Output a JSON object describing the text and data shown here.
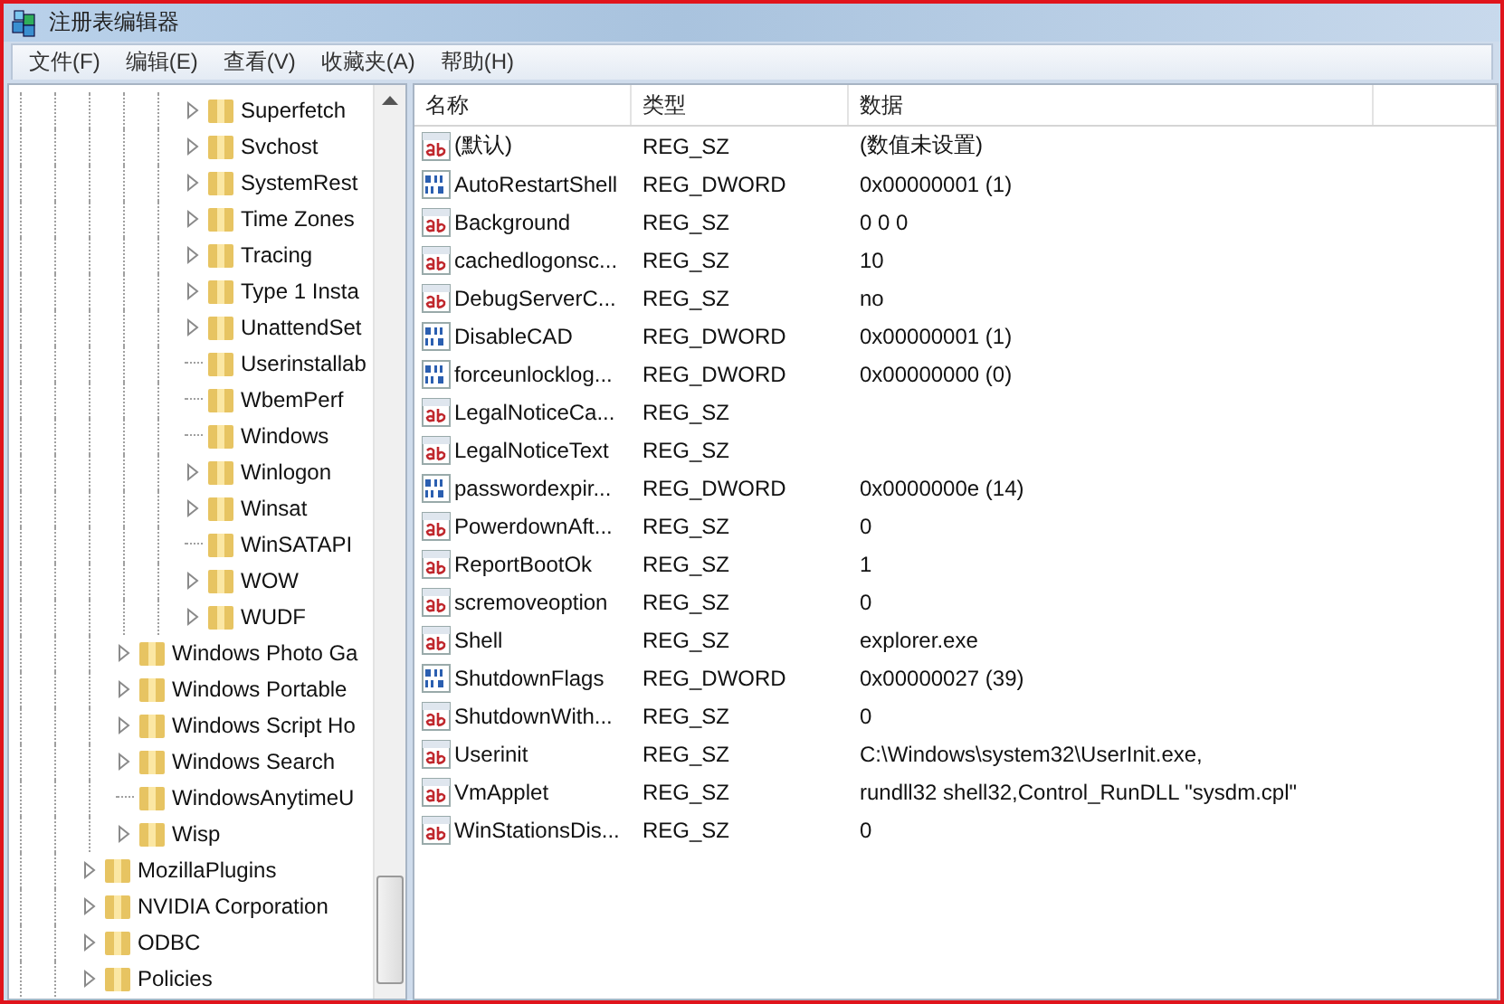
{
  "window": {
    "title": "注册表编辑器"
  },
  "menu": [
    "文件(F)",
    "编辑(E)",
    "查看(V)",
    "收藏夹(A)",
    "帮助(H)"
  ],
  "tree": {
    "items": [
      {
        "children": [
          {
            "children": [
              {
                "children": [
                  {
                    "label": "Superfetch",
                    "expandable": true
                  },
                  {
                    "label": "Svchost",
                    "expandable": true
                  },
                  {
                    "label": "SystemRest",
                    "expandable": true
                  },
                  {
                    "label": "Time Zones",
                    "expandable": true
                  },
                  {
                    "label": "Tracing",
                    "expandable": true
                  },
                  {
                    "label": "Type 1 Insta",
                    "expandable": true
                  },
                  {
                    "label": "UnattendSet",
                    "expandable": true
                  },
                  {
                    "label": "Userinstallab",
                    "expandable": false
                  },
                  {
                    "label": "WbemPerf",
                    "expandable": false
                  },
                  {
                    "label": "Windows",
                    "expandable": false
                  },
                  {
                    "label": "Winlogon",
                    "expandable": true
                  },
                  {
                    "label": "Winsat",
                    "expandable": true
                  },
                  {
                    "label": "WinSATAPI",
                    "expandable": false
                  },
                  {
                    "label": "WOW",
                    "expandable": true
                  },
                  {
                    "label": "WUDF",
                    "expandable": true
                  }
                ]
              }
            ]
          },
          {
            "label": "Windows Photo Ga",
            "expandable": true
          },
          {
            "label": "Windows Portable",
            "expandable": true
          },
          {
            "label": "Windows Script Ho",
            "expandable": true
          },
          {
            "label": "Windows Search",
            "expandable": true
          },
          {
            "label": "WindowsAnytimeU",
            "expandable": false
          },
          {
            "label": "Wisp",
            "expandable": true
          }
        ]
      },
      {
        "label": "MozillaPlugins",
        "expandable": true
      },
      {
        "label": "NVIDIA Corporation",
        "expandable": true
      },
      {
        "label": "ODBC",
        "expandable": true
      },
      {
        "label": "Policies",
        "expandable": true
      }
    ]
  },
  "table": {
    "columns": [
      "名称",
      "类型",
      "数据"
    ],
    "rows": [
      {
        "kind": "string",
        "name": "(默认)",
        "type": "REG_SZ",
        "data": "(数值未设置)"
      },
      {
        "kind": "binary",
        "name": "AutoRestartShell",
        "type": "REG_DWORD",
        "data": "0x00000001 (1)"
      },
      {
        "kind": "string",
        "name": "Background",
        "type": "REG_SZ",
        "data": "0 0 0"
      },
      {
        "kind": "string",
        "name": "cachedlogonsc...",
        "type": "REG_SZ",
        "data": "10"
      },
      {
        "kind": "string",
        "name": "DebugServerC...",
        "type": "REG_SZ",
        "data": "no"
      },
      {
        "kind": "binary",
        "name": "DisableCAD",
        "type": "REG_DWORD",
        "data": "0x00000001 (1)"
      },
      {
        "kind": "binary",
        "name": "forceunlocklog...",
        "type": "REG_DWORD",
        "data": "0x00000000 (0)"
      },
      {
        "kind": "string",
        "name": "LegalNoticeCa...",
        "type": "REG_SZ"
      },
      {
        "kind": "string",
        "name": "LegalNoticeText",
        "type": "REG_SZ"
      },
      {
        "kind": "binary",
        "name": "passwordexpir...",
        "type": "REG_DWORD",
        "data": "0x0000000e (14)"
      },
      {
        "kind": "string",
        "name": "PowerdownAft...",
        "type": "REG_SZ",
        "data": "0"
      },
      {
        "kind": "string",
        "name": "ReportBootOk",
        "type": "REG_SZ",
        "data": "1"
      },
      {
        "kind": "string",
        "name": "scremoveoption",
        "type": "REG_SZ",
        "data": "0"
      },
      {
        "kind": "string",
        "name": "Shell",
        "type": "REG_SZ",
        "data": "explorer.exe"
      },
      {
        "kind": "binary",
        "name": "ShutdownFlags",
        "type": "REG_DWORD",
        "data": "0x00000027 (39)"
      },
      {
        "kind": "string",
        "name": "ShutdownWith...",
        "type": "REG_SZ",
        "data": "0"
      },
      {
        "kind": "string",
        "name": "Userinit",
        "type": "REG_SZ",
        "data": "C:\\Windows\\system32\\UserInit.exe,"
      },
      {
        "kind": "string",
        "name": "VmApplet",
        "type": "REG_SZ",
        "data": "rundll32 shell32,Control_RunDLL \"sysdm.cpl\""
      },
      {
        "kind": "string",
        "name": "WinStationsDis...",
        "type": "REG_SZ",
        "data": "0"
      }
    ]
  }
}
